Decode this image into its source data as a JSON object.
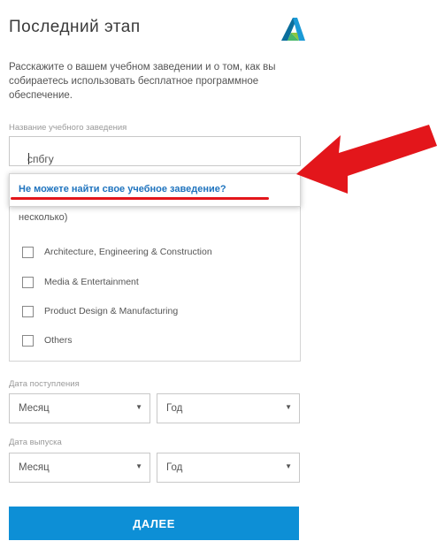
{
  "header": {
    "title": "Последний этап",
    "logo_icon": "autodesk-logo-icon"
  },
  "intro": "Расскажите о вашем учебном заведении и о том, как вы собираетесь использовать бесплатное программное обеспечение.",
  "school": {
    "label": "Название учебного заведения",
    "value": "спбгу",
    "dropdown_link": "Не можете найти свое учебное заведение?"
  },
  "usage": {
    "header_fragment": "несколько)",
    "options": [
      "Architecture, Engineering & Construction",
      "Media & Entertainment",
      "Product Design & Manufacturing",
      "Others"
    ]
  },
  "enrollment": {
    "label": "Дата поступления",
    "month": "Месяц",
    "year": "Год"
  },
  "graduation": {
    "label": "Дата выпуска",
    "month": "Месяц",
    "year": "Год"
  },
  "next_button": "ДАЛЕЕ",
  "colors": {
    "accent": "#0d8fd6",
    "link": "#1e73be",
    "annotation": "#e3161b"
  }
}
